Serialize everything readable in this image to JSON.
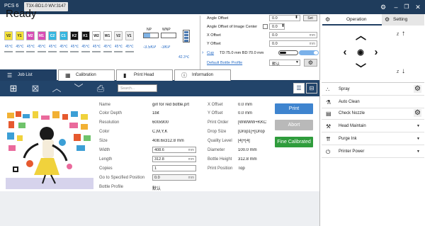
{
  "app": {
    "title": "PCS 6",
    "version": "T3X-BD1.0 WV:3147"
  },
  "status": "Ready",
  "inks": [
    {
      "label": "V2",
      "temp": "45℃",
      "color": "#f5e23a",
      "text": "#222"
    },
    {
      "label": "Y1",
      "temp": "45℃",
      "color": "#f5e23a",
      "text": "#222"
    },
    {
      "label": "M2",
      "temp": "45℃",
      "color": "#d94bb4",
      "text": "#fff"
    },
    {
      "label": "M1",
      "temp": "45℃",
      "color": "#d94bb4",
      "text": "#fff"
    },
    {
      "label": "C2",
      "temp": "45℃",
      "color": "#34b6e0",
      "text": "#fff"
    },
    {
      "label": "C1",
      "temp": "45℃",
      "color": "#34b6e0",
      "text": "#fff"
    },
    {
      "label": "K2",
      "temp": "45℃",
      "color": "#111111",
      "text": "#fff"
    },
    {
      "label": "K1",
      "temp": "45℃",
      "color": "#111111",
      "text": "#fff"
    },
    {
      "label": "W2",
      "temp": "45℃",
      "color": "#ffffff",
      "text": "#222"
    },
    {
      "label": "W1",
      "temp": "45℃",
      "color": "#ffffff",
      "text": "#222"
    },
    {
      "label": "V2",
      "temp": "45℃",
      "color": "#f0f0f0",
      "text": "#222"
    },
    {
      "label": "V1",
      "temp": "45℃",
      "color": "#f0f0f0",
      "text": "#222"
    }
  ],
  "gauges": {
    "np_label": "NP",
    "np_value": "-3.5KP",
    "np_fill": 0.45,
    "wnp_label": "WNP",
    "wnp_value": "-3KP",
    "wnp_fill": 0.0,
    "battery_value": "42.3℃"
  },
  "angle": {
    "offset_label": "Angle Offset",
    "offset_value": "0.0",
    "set_button": "Set",
    "center_label": "Angle Offset of Image Center",
    "center_value": "0.0",
    "x_offset_label": "X Offset",
    "x_offset_value": "0.0",
    "x_offset_unit": "mm",
    "y_offset_label": "Y Offset",
    "y_offset_value": "0.0",
    "y_offset_unit": "mm",
    "cup_label": "Cup",
    "cup_values": "TD:75.0 mm  BD:70.0 mm",
    "profile_label": "Default Bottle Profile",
    "profile_value": "默认"
  },
  "tabs": [
    {
      "label": "Job List",
      "active": true
    },
    {
      "label": "Calibration",
      "active": false
    },
    {
      "label": "Print Head",
      "active": false
    },
    {
      "label": "Information",
      "active": false
    }
  ],
  "search": {
    "placeholder": "Search..."
  },
  "job": {
    "name_key": "Name",
    "name": "girl for red bottle.prt",
    "depth_key": "Color Depth",
    "depth": "1bit",
    "res_key": "Resolution",
    "res": "600x900",
    "color_key": "Color",
    "color": "C,M,Y,K",
    "size_key": "Size",
    "size": "408.6x312.8 mm",
    "width_key": "Width",
    "width": "408.6",
    "width_unit": "mm",
    "length_key": "Length",
    "length": "312.8",
    "length_unit": "mm",
    "copies_key": "Copies",
    "copies": "1",
    "goto_key": "Go to Specified Position",
    "goto": "0.0",
    "goto_unit": "mm",
    "profile_key": "Bottle Profile",
    "profile": "默认",
    "xoff_key": "X Offset",
    "xoff": "0.0 mm",
    "yoff_key": "Y Offset",
    "yoff": "0.0 mm",
    "order_key": "Print Order",
    "order": "[WWWW+KKC",
    "drop_key": "Drop Size",
    "drop": "[Drop1]+[Drop",
    "quality_key": "Quality Level",
    "quality": "[4]+[4]",
    "diam_key": "Diameter",
    "diam": "100.0 mm",
    "height_key": "Bottle Height",
    "height": "312.8 mm",
    "pos_key": "Print Position",
    "pos": "Top"
  },
  "actions": {
    "print": "Print",
    "abort": "Abort",
    "fine": "Fine Calibrated"
  },
  "right": {
    "tab_operation": "Operation",
    "tab_setting": "Setting",
    "z_label": "Z",
    "functions": [
      {
        "label": "Spray",
        "gear": true
      },
      {
        "label": "Auto Clean",
        "gear": false
      },
      {
        "label": "Check Nozzle",
        "gear": true
      },
      {
        "label": "Head Maintain",
        "gear": false,
        "dropdown": true
      },
      {
        "label": "Purge Ink",
        "gear": false,
        "dropdown": true
      },
      {
        "label": "Printer Power",
        "gear": false,
        "dropdown": true
      }
    ]
  }
}
